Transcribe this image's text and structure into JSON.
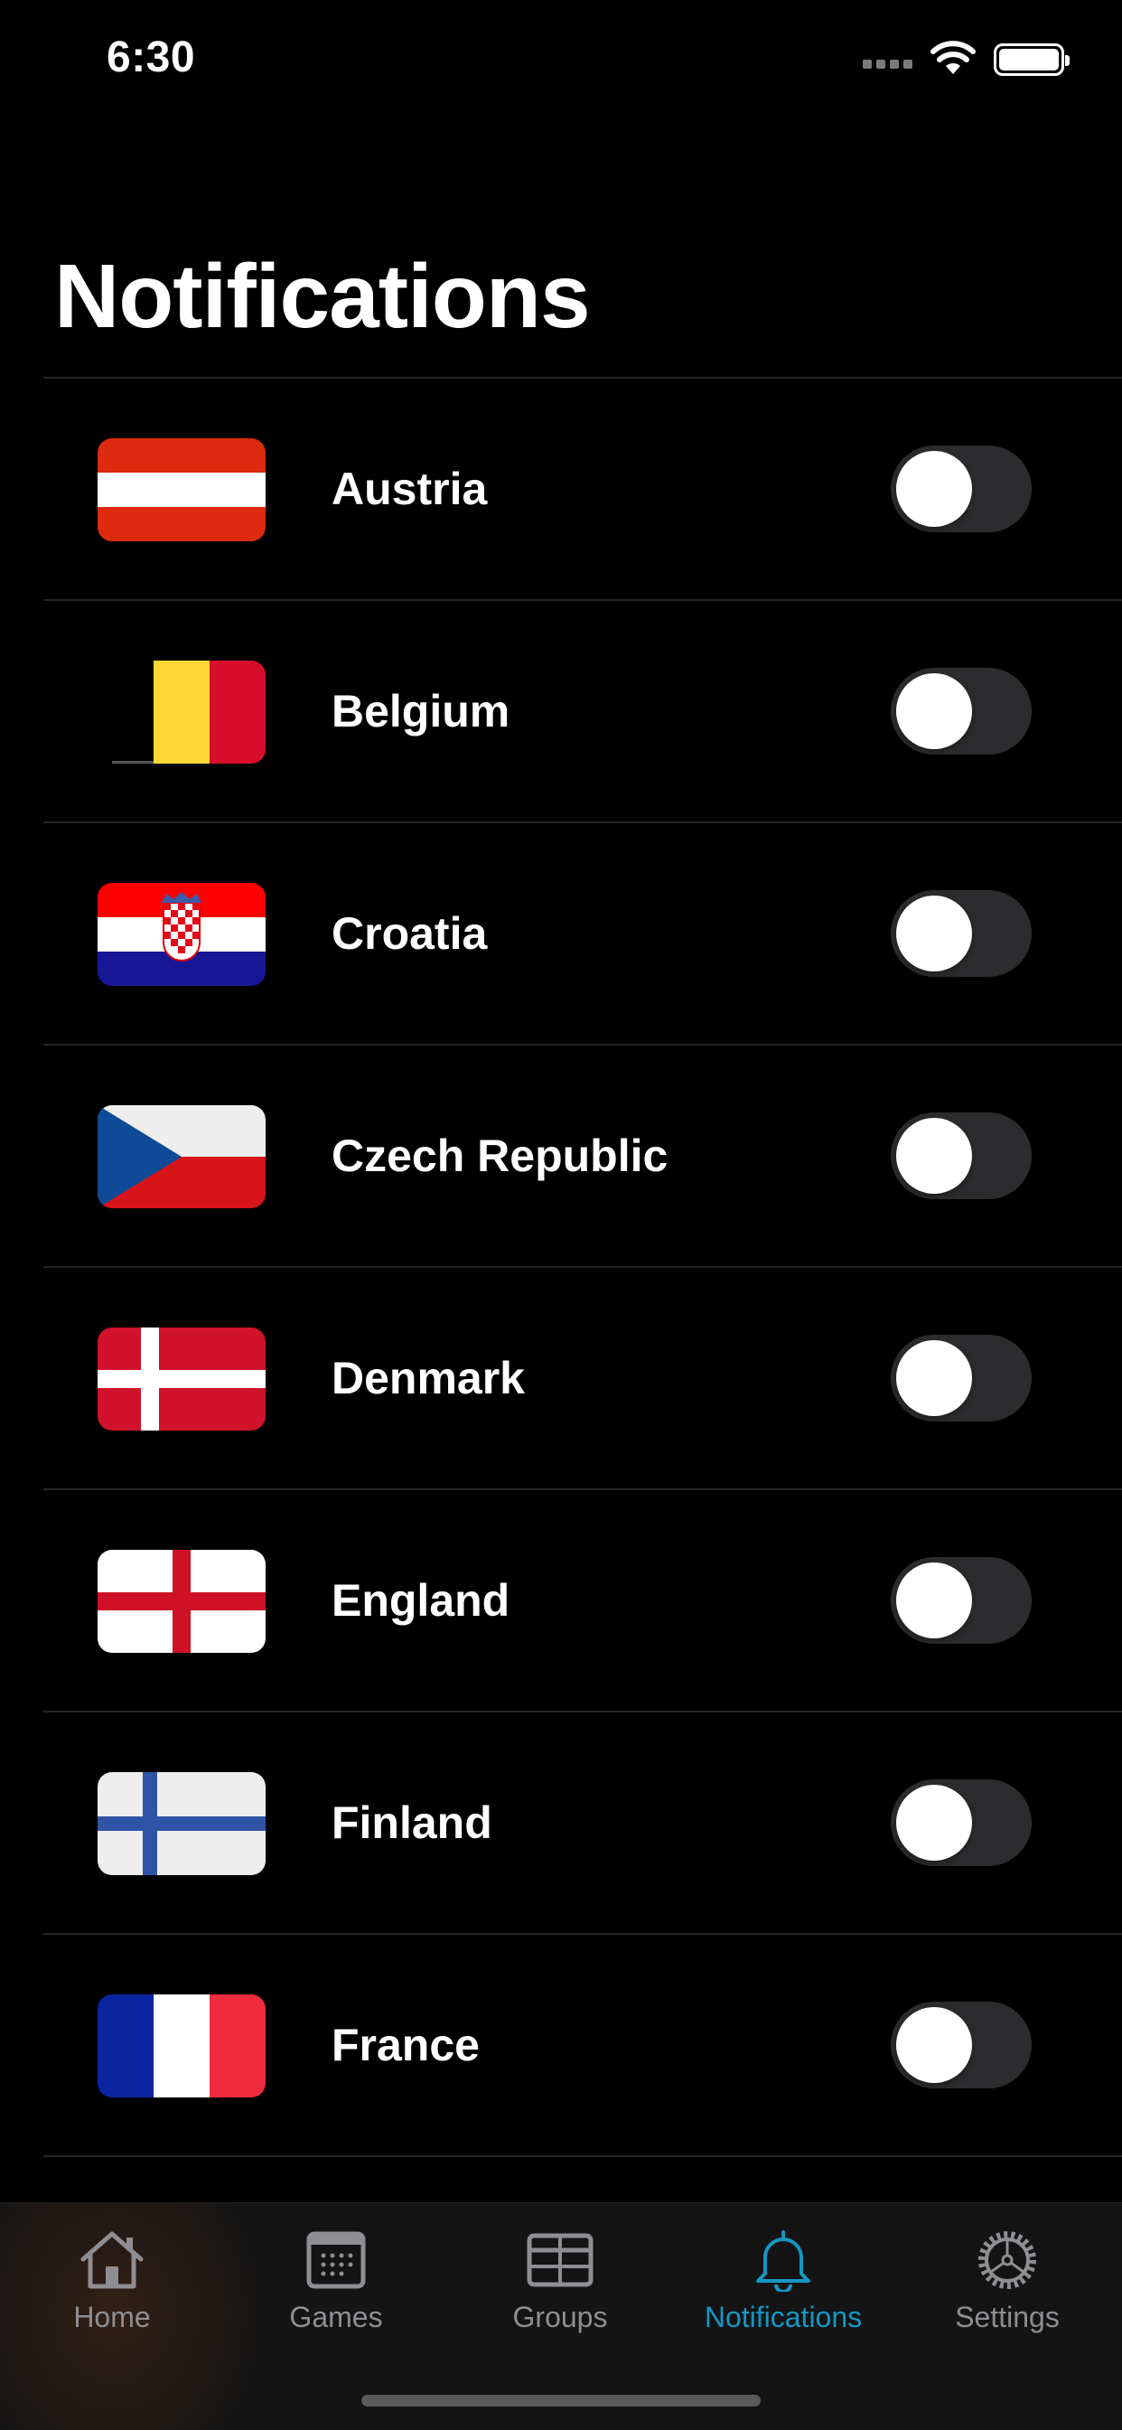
{
  "status_bar": {
    "time": "6:30"
  },
  "page": {
    "title": "Notifications"
  },
  "countries": [
    {
      "name": "Austria",
      "flag": "austria",
      "enabled": false
    },
    {
      "name": "Belgium",
      "flag": "belgium",
      "enabled": false
    },
    {
      "name": "Croatia",
      "flag": "croatia",
      "enabled": false
    },
    {
      "name": "Czech Republic",
      "flag": "czech-republic",
      "enabled": false
    },
    {
      "name": "Denmark",
      "flag": "denmark",
      "enabled": false
    },
    {
      "name": "England",
      "flag": "england",
      "enabled": false
    },
    {
      "name": "Finland",
      "flag": "finland",
      "enabled": false
    },
    {
      "name": "France",
      "flag": "france",
      "enabled": false
    }
  ],
  "tab_bar": {
    "tabs": [
      {
        "label": "Home",
        "icon": "house-icon"
      },
      {
        "label": "Games",
        "icon": "calendar-icon"
      },
      {
        "label": "Groups",
        "icon": "table-icon"
      },
      {
        "label": "Notifications",
        "icon": "bell-icon",
        "active": true
      },
      {
        "label": "Settings",
        "icon": "gear-icon"
      }
    ]
  },
  "colors": {
    "accent": "#1497c4",
    "background": "#000000",
    "toggle_off": "#2c2c2e"
  }
}
